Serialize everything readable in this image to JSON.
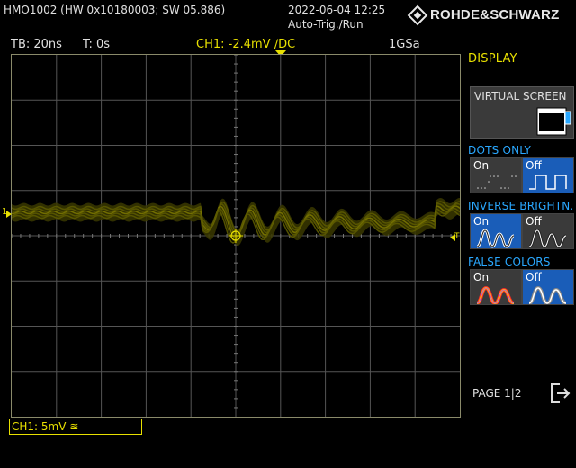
{
  "header": {
    "device": "HMO1002 (HW 0x10180003; SW 05.886)",
    "datetime": "2022-06-04 12:25",
    "trigger_mode": "Auto-Trig./Run",
    "logo": "ROHDE&SCHWARZ"
  },
  "status": {
    "timebase": "TB: 20ns",
    "time_offset": "T: 0s",
    "channel": "CH1: -2.4mV ∕DC",
    "sample_rate": "1GSa"
  },
  "menu": {
    "title": "DISPLAY",
    "virtual_screen": "VIRTUAL SCREEN",
    "dots_only": {
      "label": "DOTS ONLY",
      "on": "On",
      "off": "Off",
      "selected": "off"
    },
    "inverse_brightness": {
      "label": "INVERSE BRIGHTN.",
      "on": "On",
      "off": "Off",
      "selected": "on"
    },
    "false_colors": {
      "label": "FALSE COLORS",
      "on": "On",
      "off": "Off",
      "selected": "off"
    },
    "page": "PAGE 1|2"
  },
  "channel_box": "CH1: 5mV ≊",
  "markers": {
    "ch1": "1",
    "trigger": "T"
  },
  "colors": {
    "trace": "#e8e000",
    "grid": "#555555",
    "selected": "#1a5db8",
    "menu_label": "#2aa8ff"
  }
}
